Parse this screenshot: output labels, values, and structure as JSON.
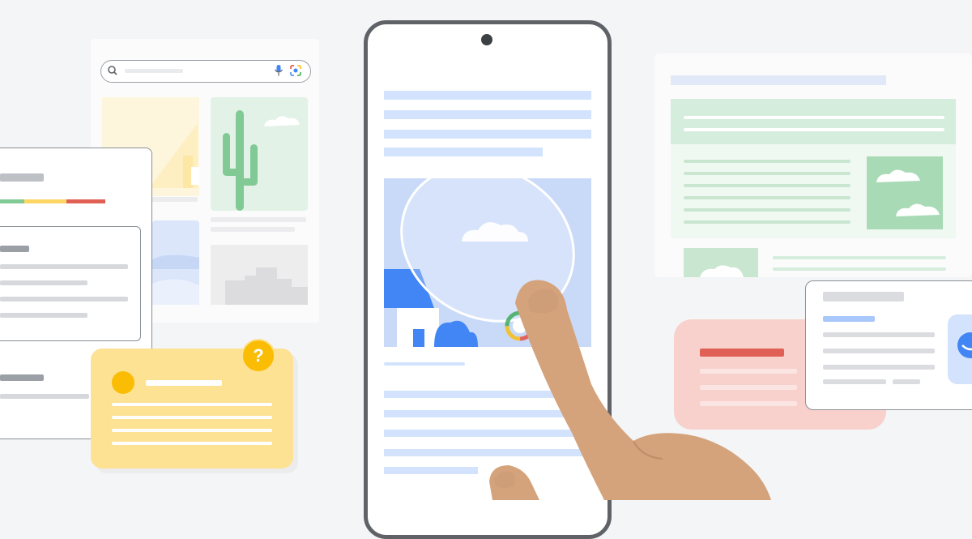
{
  "help_badge": {
    "symbol": "?"
  },
  "colors": {
    "background": "#f4f5f7",
    "google_green": "#81c995",
    "google_yellow": "#fdd663",
    "google_red": "#e06055",
    "google_blue": "#4285f4",
    "skin": "#d4a37c",
    "phone_frame": "#5f6368"
  },
  "icons": [
    "search-icon",
    "microphone-icon",
    "lens-icon",
    "cactus-icon",
    "cloud-icon",
    "house-icon",
    "circle-to-search-icon",
    "hand-icon",
    "question-icon"
  ]
}
